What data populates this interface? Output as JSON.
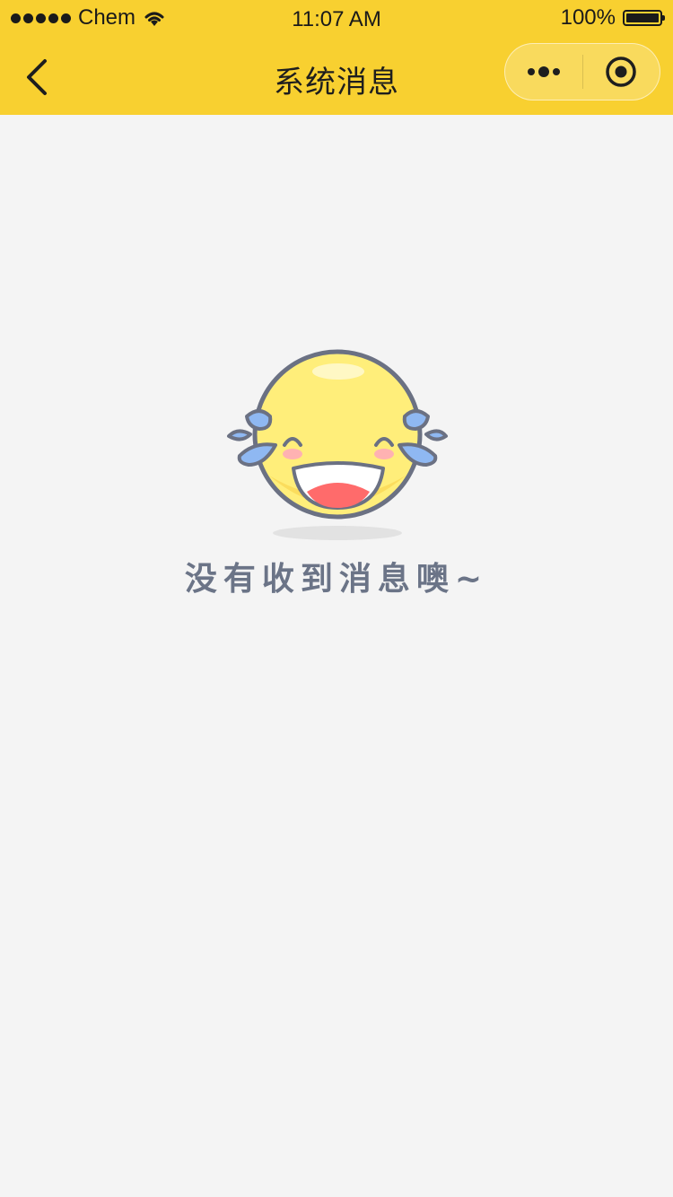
{
  "status_bar": {
    "carrier": "Chem",
    "time": "11:07 AM",
    "battery": "100%"
  },
  "nav": {
    "title": "系统消息",
    "back_icon": "chevron-left-icon",
    "more_icon": "more-dots-icon",
    "close_icon": "target-circle-icon"
  },
  "empty_state": {
    "icon": "laughing-crying-face",
    "message": "没有收到消息噢~"
  },
  "colors": {
    "nav_background": "#f8d030",
    "page_background": "#f4f4f4",
    "message_text": "#6b7487"
  }
}
